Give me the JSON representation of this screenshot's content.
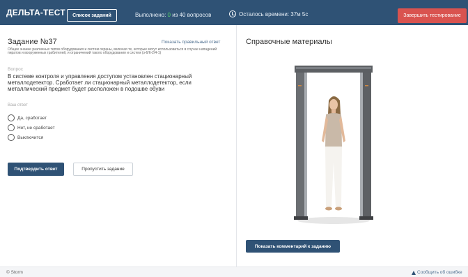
{
  "header": {
    "logo": "ДЕЛЬТА-ТЕСТ",
    "tasks_button": "Список заданий",
    "progress_prefix": "Выполнено: ",
    "progress_done": "0",
    "progress_suffix": " из 40 вопросов",
    "timer": "Осталось времени: 37м 5с",
    "finish_button": "Завершить тестирование"
  },
  "task": {
    "title": "Задание №37",
    "show_answer": "Показать правильный ответ",
    "description": "Общее знание различных типов оборудования и систем охраны, включая те, которые могут использоваться в случае нападений пиратов и вооруженных грабителей, и ограничений такого оборудования и систем (з-6/6-2/4-1)",
    "question_label": "Вопрос",
    "question_text": "В системе контроля и управления доступом установлен стационарный металлодетектор. Сработает ли стационарный металлодетектор, если металлический предмет будет расположен в подошве обуви",
    "answer_label": "Ваш ответ",
    "options": [
      "Да, сработает",
      "Нет, не сработает",
      "Выключится"
    ],
    "confirm_button": "Подтвердить ответ",
    "skip_button": "Пропустить задание"
  },
  "reference": {
    "title": "Справочные материалы",
    "comment_button": "Показать комментарий к заданию"
  },
  "footer": {
    "copyright": "© Storm",
    "report": "Сообщить об ошибке"
  },
  "colors": {
    "header_bg": "#2f5275",
    "finish_bg": "#d9534f",
    "done_count": "#55d36a",
    "link": "#4d6e8f"
  }
}
